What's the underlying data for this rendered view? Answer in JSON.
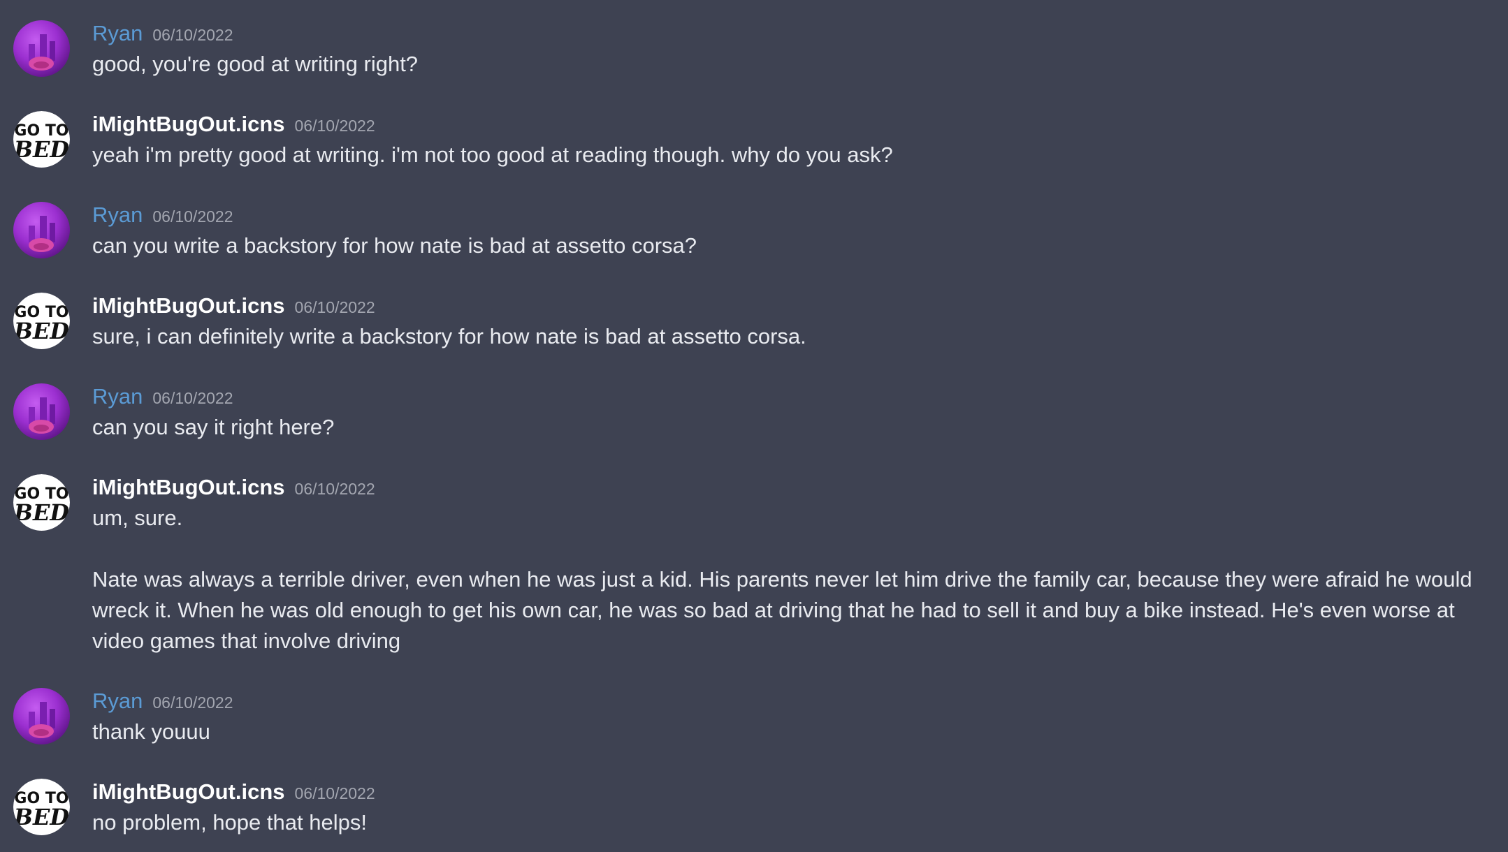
{
  "messages": [
    {
      "author": "Ryan",
      "timestamp": "06/10/2022",
      "text": "good, you're good at writing right?"
    },
    {
      "author": "iMightBugOut.icns",
      "timestamp": "06/10/2022",
      "text": "yeah i'm pretty good at writing. i'm not too good at reading though. why do you ask?"
    },
    {
      "author": "Ryan",
      "timestamp": "06/10/2022",
      "text": "can you write a backstory for how nate is bad at assetto corsa?"
    },
    {
      "author": "iMightBugOut.icns",
      "timestamp": "06/10/2022",
      "text": "sure, i can definitely write a backstory for how nate is bad at assetto corsa."
    },
    {
      "author": "Ryan",
      "timestamp": "06/10/2022",
      "text": "can you say it right here?"
    },
    {
      "author": "iMightBugOut.icns",
      "timestamp": "06/10/2022",
      "text": "um, sure.",
      "text2": "Nate was always a terrible driver, even when he was just a kid. His parents never let him drive the family car, because they were afraid he would wreck it. When he was old enough to get his own car, he was so bad at driving that he had to sell it and buy a bike instead. He's even worse at video games that involve driving"
    },
    {
      "author": "Ryan",
      "timestamp": "06/10/2022",
      "text": "thank youuu"
    },
    {
      "author": "iMightBugOut.icns",
      "timestamp": "06/10/2022",
      "text": "no problem, hope that helps!"
    }
  ],
  "avatars": {
    "ryan": {
      "icon": "purple-photo-avatar",
      "color": "#a43bd6"
    },
    "bot": {
      "icon": "go-to-bed-avatar",
      "lettering": "GO TO BED",
      "color": "#ffffff"
    }
  },
  "colors": {
    "background": "#3e4252",
    "ryan_name": "#5b9bd5",
    "bot_name": "#ffffff",
    "timestamp": "#a3a6b0",
    "text": "#e9ebf0"
  }
}
